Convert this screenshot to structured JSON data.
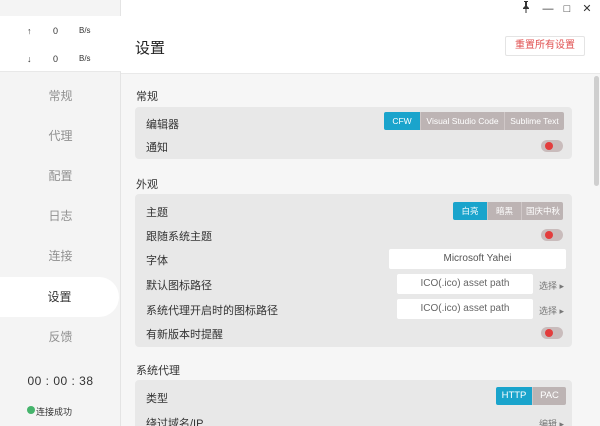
{
  "window": {
    "pin_icon": "pin-icon",
    "minimize": "—",
    "maximize": "□",
    "close": "✕"
  },
  "traffic": {
    "upload": {
      "arrow": "↑",
      "value": "0",
      "unit": "B/s"
    },
    "download": {
      "arrow": "↓",
      "value": "0",
      "unit": "B/s"
    }
  },
  "sidebar": {
    "items": [
      {
        "label": "常规"
      },
      {
        "label": "代理"
      },
      {
        "label": "配置"
      },
      {
        "label": "日志"
      },
      {
        "label": "连接"
      },
      {
        "label": "设置"
      },
      {
        "label": "反馈"
      }
    ],
    "active": "设置",
    "timer": "00 : 00 : 38",
    "status": "连接成功"
  },
  "header": {
    "title": "设置",
    "reset_label": "重置所有设置"
  },
  "sections": {
    "general": {
      "title": "常规",
      "editor_label": "编辑器",
      "editor_options": [
        "CFW",
        "Visual Studio Code",
        "Sublime Text"
      ],
      "editor_selected": "CFW",
      "notify_label": "通知"
    },
    "appearance": {
      "title": "外观",
      "theme_label": "主题",
      "theme_options": [
        "白亮",
        "暗黑",
        "国庆中秋"
      ],
      "theme_selected": "白亮",
      "follow_system_label": "跟随系统主题",
      "font_label": "字体",
      "font_value": "Microsoft Yahei",
      "default_icon_label": "默认图标路径",
      "default_icon_placeholder": "ICO(.ico) asset path",
      "proxy_icon_label": "系统代理开启时的图标路径",
      "proxy_icon_placeholder": "ICO(.ico) asset path",
      "choose_label": "选择 ▸",
      "update_remind_label": "有新版本时提醒"
    },
    "system_proxy": {
      "title": "系统代理",
      "type_label": "类型",
      "type_options": [
        "HTTP",
        "PAC"
      ],
      "type_selected": "HTTP",
      "bypass_label": "绕过域名/IP",
      "edit_label": "编辑 ▸"
    }
  },
  "colors": {
    "accent": "#1aa4cc",
    "danger": "#e33c3c",
    "success": "#45b46c"
  }
}
